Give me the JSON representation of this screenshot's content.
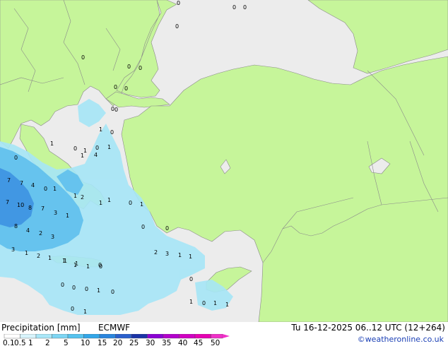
{
  "footer": {
    "title": "Precipitation [mm]",
    "model": "ECMWF",
    "valid_time": "Tu 16-12-2025 06..12 UTC (12+264)",
    "credit": "©weatheronline.co.uk"
  },
  "legend": {
    "ticks": [
      "0.1",
      "0.5",
      "1",
      "2",
      "5",
      "10",
      "15",
      "20",
      "25",
      "30",
      "35",
      "40",
      "45",
      "50"
    ],
    "colors": [
      "#ffffff",
      "#d8f4fc",
      "#a9e7f8",
      "#7dd6f4",
      "#55c3ef",
      "#32a6e8",
      "#2a85de",
      "#2a5fcc",
      "#1a33a6",
      "#8a00d4",
      "#b300cc",
      "#d100c2",
      "#e600b3",
      "#f030c8"
    ]
  },
  "colors": {
    "land": "#c6f59a",
    "sea": "#ececec",
    "border": "#8a8a8a",
    "light_rain": "#a6e6f7",
    "moderate_rain": "#5fc0ee",
    "heavy_rain": "#3b8fe0"
  },
  "map_labels": [
    "0",
    "0",
    "0",
    "0",
    "0",
    "0",
    "0",
    "0",
    "0",
    "0",
    "0",
    "1",
    "0",
    "0",
    "1",
    "1",
    "0",
    "1",
    "1",
    "4",
    "0",
    "7",
    "7",
    "4",
    "0",
    "1",
    "2",
    "1",
    "7",
    "10",
    "8",
    "7",
    "3",
    "1",
    "1",
    "1",
    "8",
    "4",
    "2",
    "3",
    "3",
    "1",
    "2",
    "1",
    "1",
    "1",
    "1",
    "0",
    "0",
    "1",
    "2",
    "3",
    "1",
    "1",
    "1",
    "1",
    "0",
    "0",
    "0",
    "0",
    "1",
    "0",
    "0",
    "1",
    "0",
    "1",
    "1",
    "0",
    "1",
    "0",
    "0"
  ]
}
